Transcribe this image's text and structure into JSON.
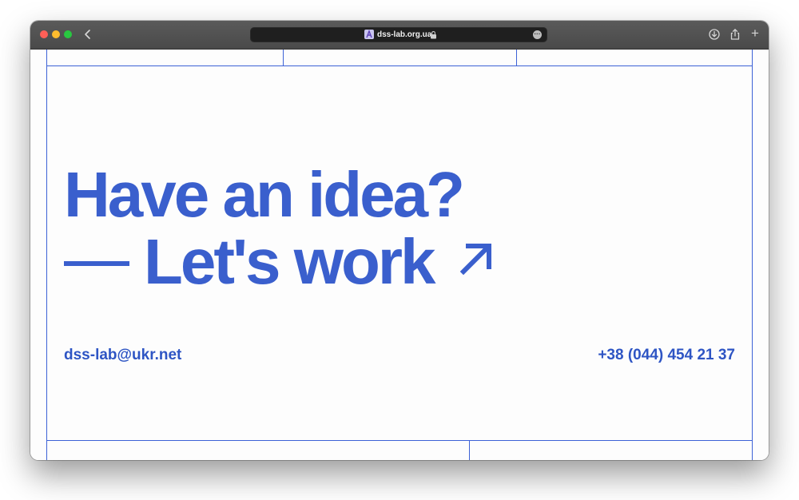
{
  "browser": {
    "url": "dss-lab.org.ua",
    "back_glyph": "‹",
    "more_glyph": "···",
    "plus_glyph": "+"
  },
  "hero": {
    "line1": "Have an idea?",
    "line2": "Let's work"
  },
  "contact": {
    "email": "dss-lab@ukr.net",
    "phone": "+38 (044) 454 21 37"
  },
  "colors": {
    "accent": "#3a5fcd",
    "grid_line": "#3d62d6",
    "toolbar": "#4f4f4f"
  },
  "icons": {
    "arrow": "arrow-up-right-icon",
    "lock": "lock-icon",
    "download": "download-icon",
    "share": "share-icon",
    "plus": "plus-icon",
    "back": "chevron-left-icon"
  }
}
